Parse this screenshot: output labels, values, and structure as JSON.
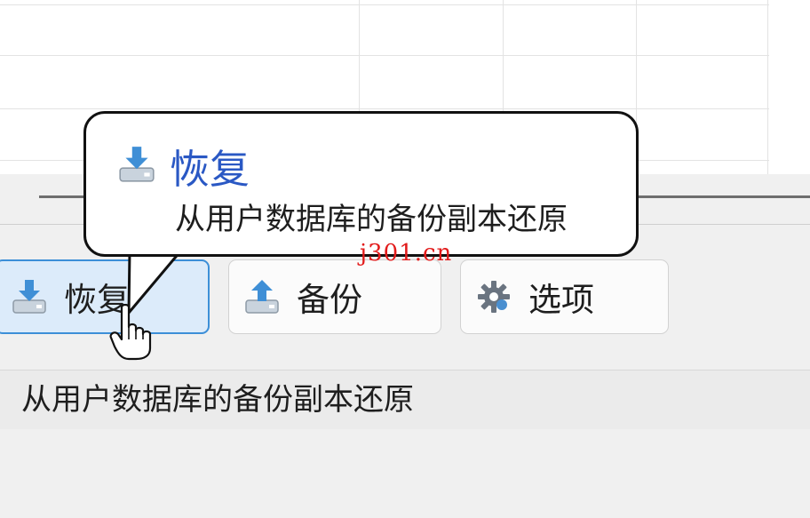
{
  "toolbar": {
    "buttons": [
      {
        "label": "恢复",
        "icon": "restore-down-arrow-icon"
      },
      {
        "label": "备份",
        "icon": "backup-up-arrow-icon"
      },
      {
        "label": "选项",
        "icon": "gear-icon"
      }
    ]
  },
  "tooltip": {
    "title": "恢复",
    "description": "从用户数据库的备份副本还原",
    "icon": "restore-down-arrow-icon"
  },
  "status_bar": {
    "text": "从用户数据库的备份副本还原"
  },
  "watermark": {
    "text": "j301.cn"
  },
  "colors": {
    "tooltip_title": "#2a58c4",
    "active_button": "#dcebfa",
    "active_border": "#3c8fd8",
    "watermark": "#e21b1b"
  }
}
